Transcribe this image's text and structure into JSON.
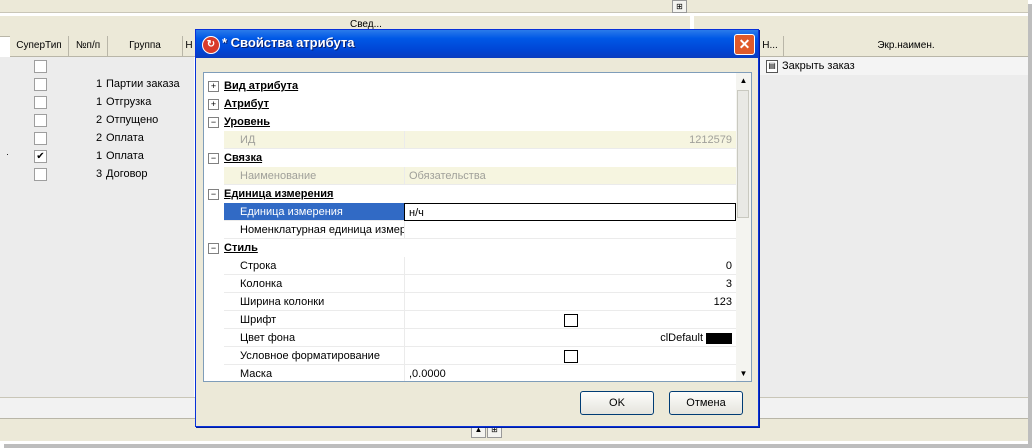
{
  "background": {
    "header_group_label": "Свед...",
    "left_columns": [
      "СуперТип",
      "№п/п",
      "Группа",
      "Н"
    ],
    "right_columns": [
      "Н...",
      "Экр.наимен."
    ],
    "rows": [
      {
        "checked": false,
        "num": "",
        "group": ""
      },
      {
        "checked": false,
        "num": "1",
        "group": "Партии заказа"
      },
      {
        "checked": false,
        "num": "1",
        "group": "Отгрузка"
      },
      {
        "checked": false,
        "num": "2",
        "group": "Отпущено"
      },
      {
        "checked": false,
        "num": "2",
        "group": "Оплата"
      },
      {
        "checked": true,
        "num": "1",
        "group": "Оплата"
      },
      {
        "checked": false,
        "num": "3",
        "group": "Договор"
      }
    ],
    "right_row_item": "Закрыть заказ"
  },
  "dialog": {
    "title": "* Свойства атрибута",
    "close_glyph": "✕",
    "ok_label": "OK",
    "cancel_label": "Отмена",
    "props": [
      {
        "kind": "cat",
        "toggle": "+",
        "label": "Вид атрибута"
      },
      {
        "kind": "cat",
        "toggle": "+",
        "label": "Атрибут"
      },
      {
        "kind": "cat",
        "toggle": "−",
        "label": "Уровень"
      },
      {
        "kind": "prop",
        "state": "readonly",
        "label": "ИД",
        "value": "1212579",
        "align": "right"
      },
      {
        "kind": "cat",
        "toggle": "−",
        "label": "Связка"
      },
      {
        "kind": "prop",
        "state": "readonly",
        "label": "Наименование",
        "value": "Обязательства",
        "align": "left"
      },
      {
        "kind": "cat",
        "toggle": "−",
        "label": "Единица измерения"
      },
      {
        "kind": "prop",
        "state": "selected",
        "label": "Единица измерения",
        "value": "н/ч",
        "align": "left"
      },
      {
        "kind": "prop",
        "state": "normal",
        "label": "Номенклатурная единица измер",
        "value": "",
        "align": "left"
      },
      {
        "kind": "cat",
        "toggle": "−",
        "label": "Стиль"
      },
      {
        "kind": "prop",
        "state": "normal",
        "label": "Строка",
        "value": "0",
        "align": "right"
      },
      {
        "kind": "prop",
        "state": "normal",
        "label": "Колонка",
        "value": "3",
        "align": "right"
      },
      {
        "kind": "prop",
        "state": "normal",
        "label": "Ширина колонки",
        "value": "123",
        "align": "right"
      },
      {
        "kind": "prop",
        "state": "normal",
        "label": "Шрифт",
        "value": "",
        "align": "center",
        "editor": "doc"
      },
      {
        "kind": "prop",
        "state": "normal",
        "label": "Цвет фона",
        "value": "clDefault",
        "align": "right",
        "editor": "swatch"
      },
      {
        "kind": "prop",
        "state": "normal",
        "label": "Условное форматирование",
        "value": "",
        "align": "center",
        "editor": "doc"
      },
      {
        "kind": "prop",
        "state": "normal",
        "label": "Маска",
        "value": ",0.0000",
        "align": "left"
      }
    ]
  },
  "colors": {
    "titlebar": "#0058e6",
    "selection": "#316ac5",
    "readonly_bg": "#f6f5e0"
  }
}
